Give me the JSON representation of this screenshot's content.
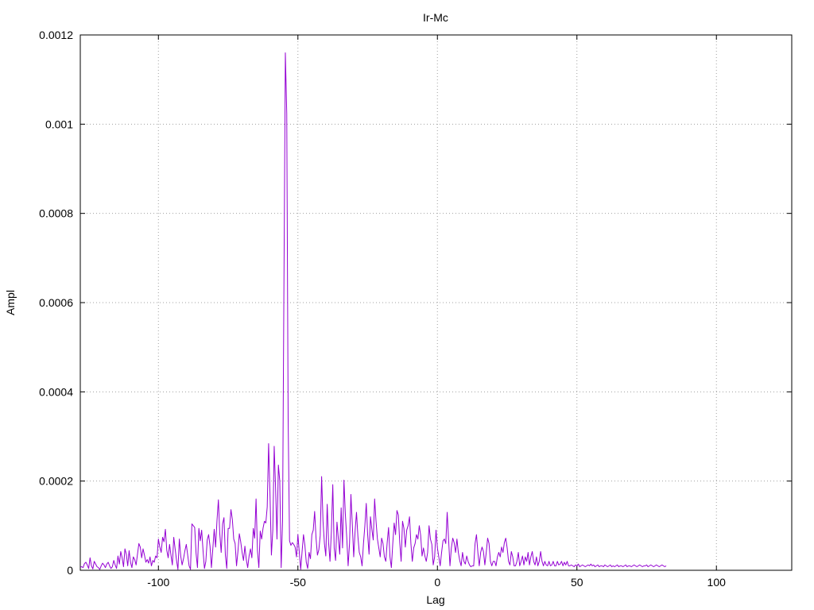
{
  "chart_data": {
    "type": "line",
    "title": "Ir-Mc",
    "xlabel": "Lag",
    "ylabel": "Ampl",
    "xlim": [
      -128,
      127
    ],
    "ylim": [
      0,
      0.0012
    ],
    "xticks": [
      -100,
      -50,
      0,
      50,
      100
    ],
    "xtick_labels": [
      "-100",
      "-50",
      "0",
      "50",
      "100"
    ],
    "yticks": [
      0,
      0.0002,
      0.0004,
      0.0006,
      0.0008,
      0.001,
      0.0012
    ],
    "ytick_labels": [
      "0",
      "0.0002",
      "0.0004",
      "0.0006",
      "0.0008",
      "0.001",
      "0.0012"
    ],
    "grid": true,
    "line_color": "#9400d3",
    "series": [
      {
        "x_start": -128,
        "x_step": 0.5,
        "values": [
          7e-06,
          8e-06,
          6e-06,
          1.5e-05,
          1.8e-05,
          1.2e-05,
          4e-06,
          2.8e-05,
          1e-05,
          3e-06,
          2e-05,
          1.4e-05,
          8e-06,
          6e-06,
          2e-06,
          1e-05,
          1.6e-05,
          1.2e-05,
          6e-06,
          1.4e-05,
          1.8e-05,
          1e-05,
          4e-06,
          8e-06,
          2.2e-05,
          1.2e-05,
          4e-06,
          3.2e-05,
          1.4e-05,
          4.2e-05,
          2.8e-05,
          8e-06,
          4.8e-05,
          3.6e-05,
          1e-05,
          4.4e-05,
          1.8e-05,
          6e-06,
          3e-05,
          2.4e-05,
          1.2e-05,
          3.6e-05,
          6e-05,
          5.2e-05,
          2.8e-05,
          4.8e-05,
          3.4e-05,
          1.8e-05,
          2.4e-05,
          1.6e-05,
          3e-05,
          1e-05,
          2.2e-05,
          1.8e-05,
          3.2e-05,
          2.8e-05,
          7e-05,
          5.2e-05,
          4e-05,
          7.4e-05,
          6.4e-05,
          9.2e-05,
          4.5e-05,
          2.8e-05,
          5.8e-05,
          3.4e-05,
          1.2e-05,
          7.4e-05,
          4.8e-05,
          2.2e-05,
          2e-06,
          7e-05,
          3.2e-05,
          1.2e-05,
          2.6e-05,
          4.4e-05,
          5.8e-05,
          3.4e-05,
          1e-05,
          2e-06,
          0.000104,
          0.0001,
          9.6e-05,
          3.8e-05,
          6e-06,
          9.4e-05,
          6.6e-05,
          9e-05,
          4.4e-05,
          4e-06,
          2e-05,
          6.8e-05,
          8e-05,
          5.4e-05,
          6e-06,
          4.8e-05,
          9.2e-05,
          5.2e-05,
          0.000112,
          0.000158,
          8.2e-05,
          4e-05,
          0.000104,
          0.000118,
          3.4e-05,
          4e-06,
          9.4e-05,
          9.4e-05,
          0.000136,
          0.000114,
          7e-05,
          6e-05,
          1e-05,
          4.2e-05,
          8.2e-05,
          6.4e-05,
          4e-05,
          2.2e-05,
          5.4e-05,
          2.4e-05,
          6e-06,
          3.2e-05,
          4.8e-05,
          2.8e-05,
          9.4e-05,
          7.2e-05,
          0.00016,
          4.4e-05,
          6e-06,
          8.8e-05,
          7e-05,
          9.4e-05,
          0.00011,
          0.000106,
          0.000142,
          0.000284,
          0.00017,
          3.4e-05,
          9e-05,
          0.000278,
          0.000184,
          7e-05,
          0.000236,
          0.0002,
          6e-06,
          0.00011,
          0.00065,
          0.00116,
          0.001024,
          0.00034,
          6.6e-05,
          5.6e-05,
          6.2e-05,
          5.8e-05,
          5.2e-05,
          3e-05,
          8e-05,
          4e-05,
          2e-06,
          4.2e-05,
          8e-05,
          5.6e-05,
          1.8e-05,
          4e-06,
          4e-05,
          2.6e-05,
          8e-05,
          9e-05,
          0.000132,
          7.2e-05,
          3.4e-05,
          4.6e-05,
          7.8e-05,
          0.00021,
          0.00011,
          6e-05,
          3.2e-05,
          0.000148,
          6.2e-05,
          2e-05,
          8.8e-05,
          0.000192,
          5e-05,
          2.2e-05,
          0.000108,
          7e-05,
          3.6e-05,
          0.00014,
          5e-05,
          0.000202,
          0.000126,
          7.4e-05,
          1e-05,
          6e-05,
          0.00017,
          0.000102,
          3e-05,
          8.8e-05,
          0.00013,
          7.6e-05,
          4e-05,
          3e-05,
          1e-05,
          6e-05,
          0.0001,
          0.00015,
          8e-05,
          3.6e-05,
          0.00012,
          9.2e-05,
          6.8e-05,
          0.00016,
          0.00011,
          7e-05,
          5e-05,
          3e-05,
          7.2e-05,
          6e-05,
          3e-05,
          2e-05,
          6.2e-05,
          9.6e-05,
          3e-05,
          6e-06,
          6e-05,
          0.000106,
          8e-05,
          0.000134,
          0.000124,
          6.2e-05,
          2e-05,
          0.00011,
          9.4e-05,
          5.2e-05,
          9e-05,
          0.0001,
          0.00012,
          6e-05,
          2e-05,
          5e-05,
          6e-05,
          8e-05,
          7e-05,
          0.0001,
          7.8e-05,
          3.2e-05,
          5e-05,
          3.2e-05,
          2e-05,
          4e-05,
          0.0001,
          7e-05,
          5.8e-05,
          1.2e-05,
          3e-05,
          9e-05,
          5e-05,
          3e-05,
          1e-05,
          4e-05,
          6.6e-05,
          7e-05,
          6e-05,
          0.00013,
          7e-05,
          1e-05,
          5e-05,
          7.2e-05,
          6.2e-05,
          4e-05,
          7e-05,
          4e-05,
          2.2e-05,
          1e-05,
          4e-05,
          2e-05,
          1.4e-05,
          3.2e-05,
          2e-05,
          1.2e-05,
          8e-06,
          1e-05,
          1e-05,
          6e-05,
          8e-05,
          4e-05,
          1e-05,
          4e-05,
          5.2e-05,
          4.2e-05,
          1.2e-05,
          4e-05,
          7.2e-05,
          6e-05,
          2e-05,
          1e-05,
          2e-05,
          2e-05,
          1e-05,
          3e-05,
          4e-05,
          3e-05,
          5.2e-05,
          4e-05,
          6.2e-05,
          7.2e-05,
          5e-05,
          2e-05,
          1.2e-05,
          4.2e-05,
          3e-05,
          1e-05,
          1e-05,
          2e-05,
          4e-05,
          1e-05,
          2e-05,
          3.2e-05,
          1.2e-05,
          3e-05,
          2e-05,
          4e-05,
          1.2e-05,
          3e-05,
          4.2e-05,
          2e-05,
          1.2e-05,
          3e-05,
          1e-05,
          2e-05,
          4.2e-05,
          2e-05,
          1e-05,
          2e-05,
          1.2e-05,
          1e-05,
          2e-05,
          1e-05,
          1.2e-05,
          2e-05,
          1e-05,
          1e-05,
          2e-05,
          1.2e-05,
          1.4e-05,
          2e-05,
          1e-05,
          1.8e-05,
          1.2e-05,
          2e-05,
          1e-05,
          1e-05,
          1.2e-05,
          1e-05,
          8e-06,
          1.2e-05,
          1e-05,
          1.4e-05,
          8e-06,
          1e-05,
          1.2e-05,
          1e-05,
          8e-06,
          1e-05,
          1.2e-05,
          1e-05,
          1.4e-05,
          1e-05,
          1.2e-05,
          8e-06,
          1e-05,
          1.2e-05,
          8e-06,
          1e-05,
          1e-05,
          8e-06,
          1.2e-05,
          1e-05,
          8e-06,
          1e-05,
          1.2e-05,
          8e-06,
          1e-05,
          8e-06,
          1e-05,
          1.2e-05,
          8e-06,
          1e-05,
          1e-05,
          8e-06,
          1e-05,
          1.2e-05,
          8e-06,
          1e-05,
          1e-05,
          8e-06,
          1e-05,
          1.2e-05,
          1e-05,
          8e-06,
          1e-05,
          1.2e-05,
          1e-05,
          8e-06,
          1e-05,
          1e-05,
          1.2e-05,
          8e-06,
          1e-05,
          1.2e-05,
          1e-05,
          8e-06,
          1e-05,
          1.2e-05,
          1e-05,
          8e-06,
          1e-05,
          1.2e-05,
          1e-05,
          8e-06,
          1e-05
        ]
      }
    ]
  }
}
